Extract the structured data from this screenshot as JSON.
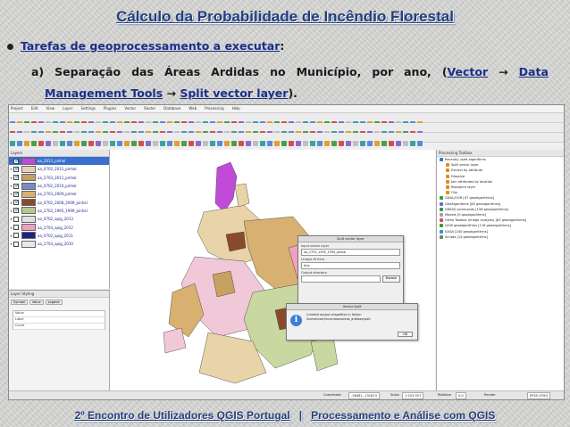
{
  "slide": {
    "title": "Cálculo da Probabilidade de Incêndio Florestal",
    "bullet_link": "Tarefas de geoprocessamento a executar",
    "bullet_tail": ":",
    "sub_words": [
      "a)",
      "Separação",
      "das",
      "Áreas",
      "Ardidas",
      "no",
      "Município,",
      "por",
      "ano,"
    ],
    "sub_open": "(",
    "sub_vector": "Vector",
    "sub_arrow1": "→",
    "sub_data": "Data",
    "sub_mgmt": "Management Tools",
    "sub_arrow2": "→",
    "sub_split": "Split vector layer",
    "sub_close": ").",
    "footer_left": "2º Encontro de Utilizadores QGIS Portugal",
    "footer_sep": "|",
    "footer_right": "Processamento e Análise com QGIS"
  },
  "qgis": {
    "menu": [
      "Project",
      "Edit",
      "View",
      "Layer",
      "Settings",
      "Plugins",
      "Vector",
      "Raster",
      "Database",
      "Web",
      "Processing",
      "Help"
    ],
    "layers_title": "Layers",
    "layers": [
      {
        "label": "aa_2013_pinhal",
        "color": "#c24ad8",
        "checked": true,
        "selected": true
      },
      {
        "label": "aa_0702_2012_pinhal",
        "color": "#e8d0b8",
        "checked": true,
        "selected": false
      },
      {
        "label": "aa_2703_2011_pinhal",
        "color": "#c8a060",
        "checked": true,
        "selected": false
      },
      {
        "label": "aa_0702_2010_pinhal",
        "color": "#7a8ac8",
        "checked": true,
        "selected": false
      },
      {
        "label": "aa_2703_2009_pinhal",
        "color": "#d8b070",
        "checked": true,
        "selected": false
      },
      {
        "label": "aa_0702_2008_2009_pinhal",
        "color": "#8a4a2a",
        "checked": true,
        "selected": false
      },
      {
        "label": "aa_2703_1995_1999_pinhal",
        "color": "#b8c890",
        "checked": true,
        "selected": false
      },
      {
        "label": "aa_0702_apig_2013",
        "color": "#e0e0e0",
        "checked": false,
        "selected": false
      },
      {
        "label": "aa_2703_apig_2012",
        "color": "#f0a0c0",
        "checked": false,
        "selected": false
      },
      {
        "label": "aa_0702_apig_2011",
        "color": "#202080",
        "checked": false,
        "selected": false
      },
      {
        "label": "aa_2703_apig_2010",
        "color": "#e8e8e8",
        "checked": false,
        "selected": false
      }
    ],
    "style_title": "Layer Styling",
    "style_tabs": [
      "Symbol",
      "Value",
      "Legend"
    ],
    "style_rows": [
      "Value",
      "Label",
      "Count"
    ],
    "toolbox_title": "Processing Toolbox",
    "toolbox_items": [
      "Recently used algorithms",
      "Split vector layer",
      "Extract by attribute",
      "Dissolve",
      "Join attributes by location",
      "Reproject layer",
      "Clip",
      "GDAL/OGR [47 geoalgorithms]",
      "GeoAlgorithms [85 geoalgorithms]",
      "GRASS commands [156 geoalgorithms]",
      "Models [0 geoalgorithms]",
      "Orfeo Toolbox (image analysis) [83 geoalgorithms]",
      "QGIS geoalgorithms [116 geoalgorithms]",
      "SAGA [240 geoalgorithms]",
      "Scripts [14 geoalgorithms]"
    ],
    "split_dialog": {
      "title": "Split vector layer",
      "input_label": "Input vector layer",
      "input_value": "aa_2703_1995_1999_pinhal",
      "field_label": "Unique ID field",
      "field_value": "Ano",
      "output_label": "Output directory",
      "output_value": "",
      "browse": "Browse",
      "run": "Run",
      "close": "Close"
    },
    "info_dialog": {
      "title": "Vector Split",
      "line1": "Created output shapefiles in folder:",
      "line2": "/home/user/incendios/areas_ardidas/split",
      "ok": "OK"
    },
    "status": {
      "coordinate": "Coordinate",
      "coord_value": "-36481,-131813",
      "scale": "Scale",
      "scale_value": "1:253 557",
      "rotation": "Rotation",
      "rotation_value": "0.0",
      "render": "Render",
      "epsg": "EPSG:3763"
    }
  }
}
